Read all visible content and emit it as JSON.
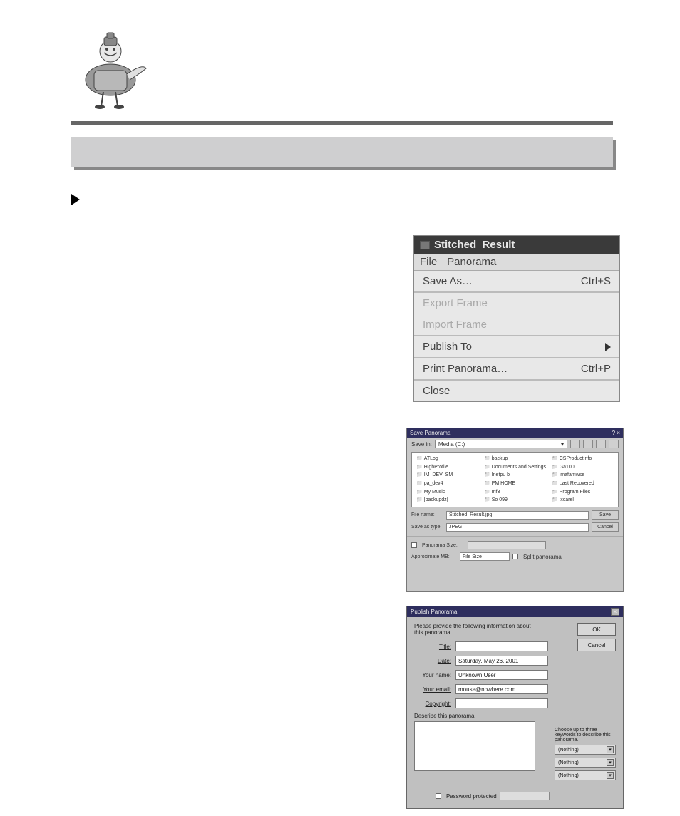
{
  "menu": {
    "window_title": "Stitched_Result",
    "menubar": {
      "file": "File",
      "panorama": "Panorama"
    },
    "save_as": "Save As…",
    "save_as_shortcut": "Ctrl+S",
    "export_frame": "Export Frame",
    "import_frame": "Import Frame",
    "publish_to": "Publish To",
    "print_panorama": "Print Panorama…",
    "print_shortcut": "Ctrl+P",
    "close": "Close"
  },
  "save_dialog": {
    "title": "Save Panorama",
    "close_glyphs": "? ×",
    "save_in_label": "Save in:",
    "save_in_value": "Media (C:)",
    "folders": [
      "ATLog",
      "backup",
      "CSProductInfo",
      "HighProfile",
      "Documents and Settings",
      "Ga100",
      "IM_DEV_SM",
      "Inetpu b",
      "imafamwse",
      "pa_dev4",
      "PM HOME",
      "Last Recovered",
      "My Music",
      "mf3",
      "Program Files",
      "[backupdz]",
      "So 099",
      "ixcarel"
    ],
    "file_name_label": "File name:",
    "file_name_value": "Stitched_Result.jpg",
    "save_as_type_label": "Save as type:",
    "save_as_type_value": "JPEG",
    "save_btn": "Save",
    "cancel_btn": "Cancel",
    "pano_size_label": "Panorama Size:",
    "pano_size_value": "",
    "approx_mb_label": "Approximate MB:",
    "approx_mb_value": "File Size",
    "split_label": "Split panorama"
  },
  "publish_dialog": {
    "title": "Publish Panorama",
    "intro": "Please provide the following information about this panorama.",
    "fields": {
      "title_label": "Title:",
      "title_value": "",
      "date_label": "Date:",
      "date_value": "Saturday, May 26, 2001",
      "name_label": "Your name:",
      "name_value": "Unknown User",
      "email_label": "Your email:",
      "email_value": "mouse@nowhere.com",
      "copyright_label": "Copyright:",
      "copyright_value": ""
    },
    "describe_label": "Describe this panorama:",
    "ok": "OK",
    "cancel": "Cancel",
    "keywords_hint": "Choose up to three keywords to describe this panorama.",
    "keyword_placeholder": "(Nothing)",
    "password_label": "Password protected"
  }
}
